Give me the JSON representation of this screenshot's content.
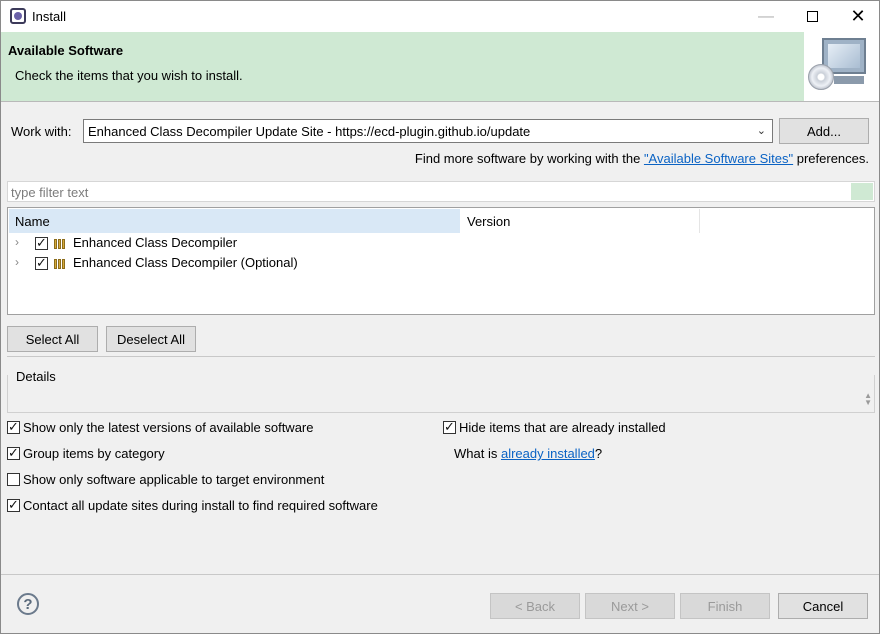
{
  "window": {
    "title": "Install"
  },
  "banner": {
    "title": "Available Software",
    "subtitle": "Check the items that you wish to install."
  },
  "work_with": {
    "label": "Work with:",
    "value": "Enhanced Class Decompiler Update Site - https://ecd-plugin.github.io/update",
    "add_label": "Add...",
    "find_more_prefix": "Find more software by working with the ",
    "find_more_link": "\"Available Software Sites\"",
    "find_more_suffix": " preferences."
  },
  "filter": {
    "placeholder": "type filter text"
  },
  "table": {
    "columns": [
      "Name",
      "Version"
    ],
    "rows": [
      {
        "name": "Enhanced Class Decompiler",
        "version": "",
        "checked": true
      },
      {
        "name": "Enhanced Class Decompiler (Optional)",
        "version": "",
        "checked": true
      }
    ]
  },
  "selection": {
    "select_all": "Select All",
    "deselect_all": "Deselect All"
  },
  "details": {
    "label": "Details"
  },
  "options": {
    "show_latest": {
      "label": "Show only the latest versions of available software",
      "checked": true
    },
    "group_by_category": {
      "label": "Group items by category",
      "checked": true
    },
    "show_applicable": {
      "label": "Show only software applicable to target environment",
      "checked": false
    },
    "contact_all_sites": {
      "label": "Contact all update sites during install to find required software",
      "checked": true
    },
    "hide_installed": {
      "label": "Hide items that are already installed",
      "checked": true
    },
    "what_is_prefix": "What is ",
    "what_is_link": "already installed",
    "what_is_suffix": "?"
  },
  "footer": {
    "help_icon": "?",
    "back": "< Back",
    "next": "Next >",
    "finish": "Finish",
    "cancel": "Cancel"
  },
  "colors": {
    "banner_bg": "#cfe9d3",
    "header_selected": "#d9e8f6",
    "link": "#0b63c4"
  }
}
